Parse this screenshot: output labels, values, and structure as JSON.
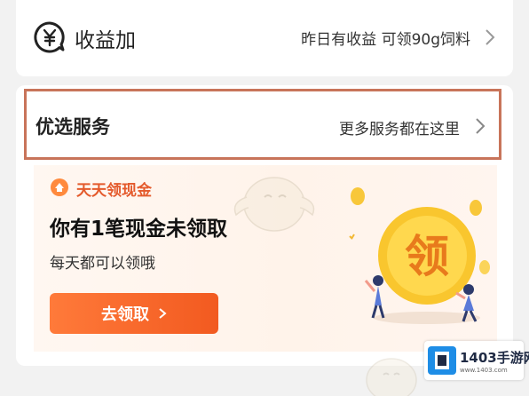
{
  "earn": {
    "title": "收益加",
    "hint": "昨日有收益 可领90g饲料",
    "icon": "yuan-bubble-icon"
  },
  "services": {
    "title": "优选服务",
    "more": "更多服务都在这里",
    "highlight_color": "#c8745a"
  },
  "promo": {
    "tag": "天天领现金",
    "title": "你有1笔现金未领取",
    "subtitle": "每天都可以领哦",
    "button": "去领取",
    "coin_char": "领",
    "accent": "#f25a20"
  },
  "watermark": {
    "brand": "1403手游网",
    "url": "www.1403.com"
  }
}
